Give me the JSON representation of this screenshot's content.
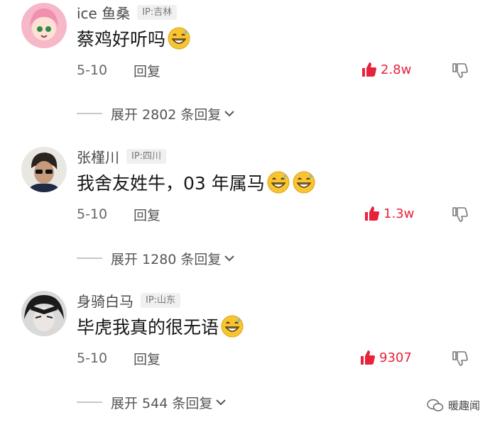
{
  "comments": [
    {
      "username": "ice 鱼桑",
      "ip": "IP:吉林",
      "text": "蔡鸡好听吗",
      "emoji_count": 1,
      "date": "5-10",
      "reply_label": "回复",
      "likes": "2.8w",
      "expand_label": "展开 2802 条回复",
      "avatar": "anime-girl-pink-hair"
    },
    {
      "username": "张槿川",
      "ip": "IP:四川",
      "text": "我舍友姓牛，03 年属马",
      "emoji_count": 2,
      "date": "5-10",
      "reply_label": "回复",
      "likes": "1.3w",
      "expand_label": "展开 1280 条回复",
      "avatar": "person-sunglasses"
    },
    {
      "username": "身骑白马",
      "ip": "IP:山东",
      "text": "毕虎我真的很无语",
      "emoji_count": 1,
      "date": "5-10",
      "reply_label": "回复",
      "likes": "9307",
      "expand_label": "展开 544 条回复",
      "avatar": "anime-dark-hair"
    }
  ],
  "watermark": "暖趣闻",
  "icons": {
    "emoji": "grinning-sweat-emoji",
    "like": "thumbs-up-icon",
    "dislike": "thumbs-down-icon",
    "expand": "chevron-down-icon"
  },
  "colors": {
    "like": "#e8223a",
    "emoji": "#f7c531"
  }
}
